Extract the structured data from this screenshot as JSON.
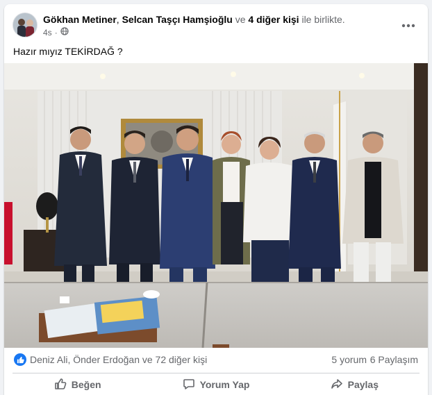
{
  "post": {
    "authors": {
      "primary": "Gökhan Metiner",
      "separator": ", ",
      "secondary": "Selcan Taşçı Hamşioğlu",
      "with": " ve ",
      "others": "4 diğer kişi",
      "suffix": " ile birlikte."
    },
    "time": "4s",
    "privacy_icon": "globe-icon",
    "more_icon": "more-horizontal-icon",
    "caption": "Hazır mıyız TEKİRDAĞ ?"
  },
  "reactions": {
    "icon": "like-icon",
    "names": "Deniz Ali, Önder Erdoğan ve 72 diğer kişi",
    "comments": "5 yorum",
    "shares": "6 Paylaşım"
  },
  "actions": [
    {
      "label": "Beğen",
      "icon": "thumbs-up-icon"
    },
    {
      "label": "Yorum Yap",
      "icon": "comment-icon"
    },
    {
      "label": "Paylaş",
      "icon": "share-icon"
    }
  ],
  "colors": {
    "accent": "#1877f2",
    "muted_text": "#65676b",
    "text": "#050505"
  }
}
